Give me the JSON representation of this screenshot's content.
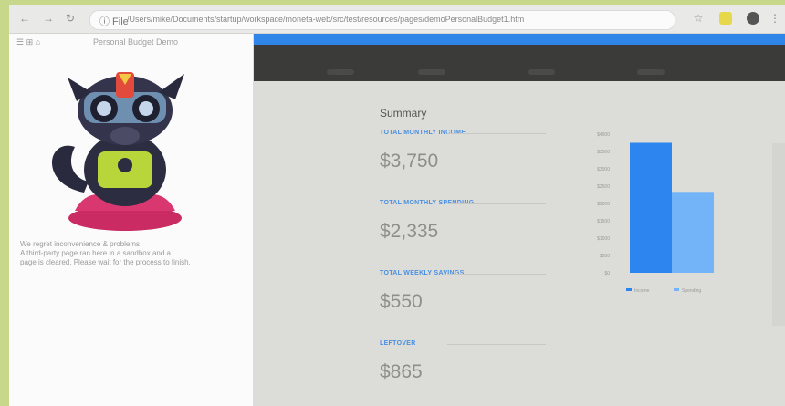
{
  "browser": {
    "address_info": "ⓘ File",
    "url": "/Users/mike/Documents/startup/workspace/moneta-web/src/test/resources/pages/demoPersonalBudget1.htm"
  },
  "left_pane": {
    "toolbar": "☰ ⊞ ⌂",
    "title": "Personal Budget Demo",
    "note_lines": [
      "We regret inconvenience & problems",
      "A third-party page ran here in a sandbox and a",
      "page is cleared. Please wait for the process to finish."
    ]
  },
  "summary": {
    "title": "Summary",
    "stats": [
      {
        "label": "TOTAL MONTHLY INCOME",
        "value": "$3,750"
      },
      {
        "label": "TOTAL MONTHLY SPENDING",
        "value": "$2,335"
      },
      {
        "label": "TOTAL WEEKLY SAVINGS",
        "value": "$550"
      },
      {
        "label": "LEFTOVER",
        "value": "$865"
      }
    ]
  },
  "colors": {
    "accent_blue": "#2f86e8",
    "dark_nav": "#3b3b39",
    "bar_income": "#2d86f0",
    "bar_spending": "#73b4f8"
  },
  "chart_data": {
    "type": "bar",
    "categories": [
      "Income",
      "Spending"
    ],
    "values": [
      3750,
      2335
    ],
    "ylim": [
      0,
      4000
    ],
    "yticks": [
      "$4000",
      "$3500",
      "$3000",
      "$2500",
      "$2000",
      "$1500",
      "$1000",
      "$500",
      "$0"
    ],
    "legend": [
      "Income",
      "Spending"
    ],
    "legend_position": "bottom",
    "colors": [
      "#2d86f0",
      "#73b4f8"
    ],
    "grid": false
  }
}
